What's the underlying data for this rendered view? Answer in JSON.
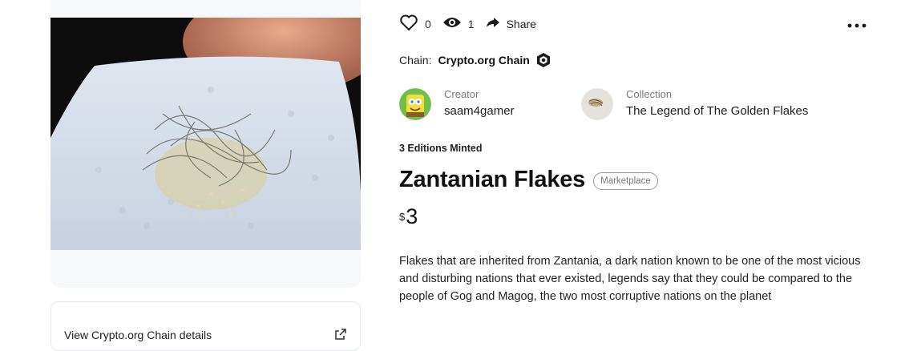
{
  "media": {
    "details_link": "View Crypto.org Chain details"
  },
  "actions": {
    "likes": "0",
    "views": "1",
    "share_label": "Share"
  },
  "chain": {
    "label": "Chain:",
    "name": "Crypto.org Chain"
  },
  "creator": {
    "role": "Creator",
    "name": "saam4gamer"
  },
  "collection": {
    "role": "Collection",
    "name": "The Legend of The Golden Flakes"
  },
  "editions": "3 Editions Minted",
  "nft": {
    "title": "Zantanian Flakes",
    "badge": "Marketplace",
    "currency": "$",
    "price": "3",
    "description": "Flakes that are inherited from Zantania, a dark nation known to be one of the most vicious and disturbing nations that ever existed, legends say that they could be compared to the people of Gog and Magog, the two most corruptive nations on the planet"
  },
  "icons": [
    "heart-icon",
    "eye-icon",
    "share-arrow-icon",
    "more-dots-icon",
    "chain-hex-icon",
    "external-link-icon"
  ]
}
